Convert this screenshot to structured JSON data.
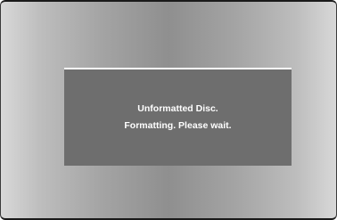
{
  "dialog": {
    "line1": "Unformatted Disc.",
    "line2": "Formatting. Please wait."
  },
  "colors": {
    "dialog_background": "#6e6e6e",
    "dialog_text": "#ffffff",
    "screen_gradient_center": "#8f8f8f",
    "screen_gradient_edge": "#d8d8d8"
  }
}
